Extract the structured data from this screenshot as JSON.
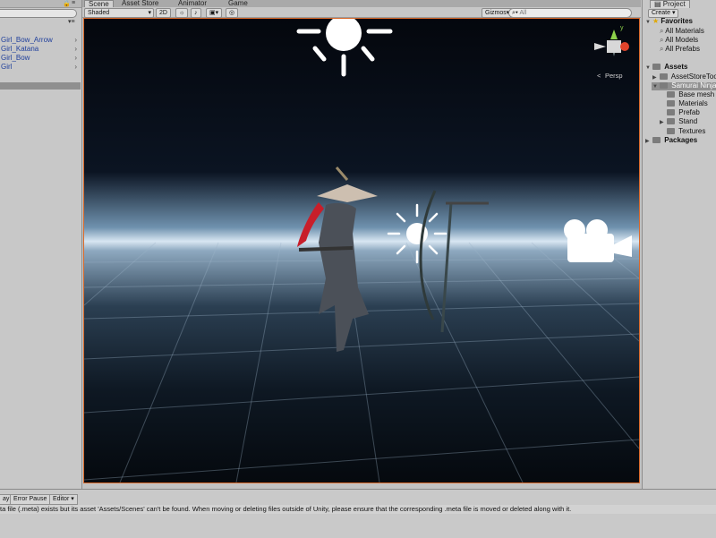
{
  "hierarchy": {
    "items": [
      {
        "label": "Girl_Bow_Arrow"
      },
      {
        "label": "Girl_Katana"
      },
      {
        "label": "Girl_Bow"
      },
      {
        "label": "Girl"
      }
    ]
  },
  "scene_tabs": {
    "scene": "Scene",
    "asset_store": "Asset Store",
    "animator": "Animator",
    "game": "Game"
  },
  "scene_toolbar": {
    "draw_mode": "Shaded",
    "mode_2d": "2D",
    "gizmos": "Gizmos",
    "search_placeholder": "All"
  },
  "scene_view": {
    "projection_label": "Persp",
    "orientation_gizmo": {
      "y_label": "y"
    }
  },
  "project": {
    "tab_label": "Project",
    "create_label": "Create",
    "favorites_label": "Favorites",
    "favorites": [
      "All Materials",
      "All Models",
      "All Prefabs"
    ],
    "assets_label": "Assets",
    "assets": [
      {
        "label": "AssetStoreTools",
        "display": "AssetStoreToo"
      },
      {
        "label": "Samurai Ninja",
        "display": "Samurai Ninja"
      }
    ],
    "samurai_children": [
      "Base mesh",
      "Materials",
      "Prefab",
      "Stand",
      "Textures"
    ],
    "packages_label": "Packages"
  },
  "console": {
    "play_label": "ay",
    "error_pause_label": "Error Pause",
    "editor_label": "Editor",
    "message": "ta file (.meta) exists but its asset 'Assets/Scenes' can't be found. When moving or deleting files outside of Unity, please ensure that the corresponding .meta file is moved or deleted along with it."
  },
  "colors": {
    "accent_border": "#d9692b",
    "selection_bg": "#8f8f8f",
    "link_blue": "#1f3f9c"
  }
}
